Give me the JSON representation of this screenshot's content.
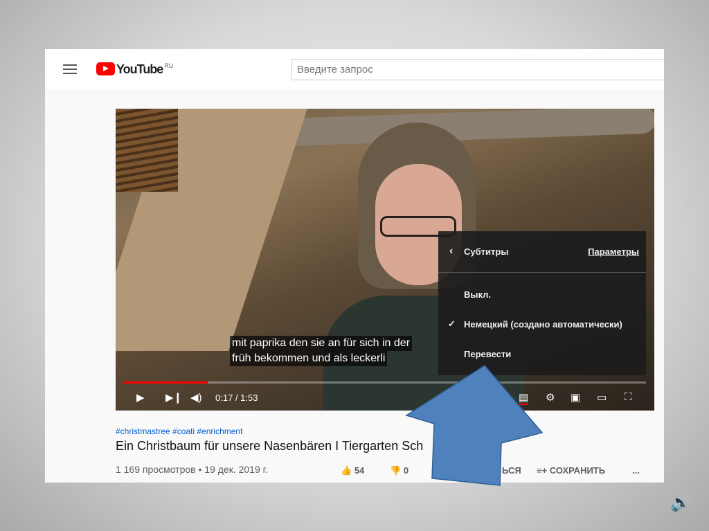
{
  "header": {
    "logo_text": "YouTube",
    "logo_region": "RU",
    "search_placeholder": "Введите запрос"
  },
  "video": {
    "subtitles": [
      "mit paprika den sie an für sich in der",
      "früh bekommen und als leckerli"
    ],
    "time": "0:17 / 1:53",
    "progress": 0.16
  },
  "subtitle_menu": {
    "title": "Субтитры",
    "options_link": "Параметры",
    "items": [
      {
        "label": "Выкл.",
        "checked": false
      },
      {
        "label": "Немецкий (создано автоматически)",
        "checked": true
      },
      {
        "label": "Перевести",
        "checked": false
      }
    ]
  },
  "info": {
    "tags": "#christmastree #coati #enrichment",
    "title": "Ein Christbaum für unsere Nasenbären I Tiergarten Sch",
    "meta": "1 169 просмотров • 19 дек. 2019 г.",
    "likes": "54",
    "dislikes": "0",
    "share_partial": "ЬСЯ",
    "save": "СОХРАНИТЬ",
    "more": "..."
  },
  "colors": {
    "arrow": "#4f81bd",
    "accent": "#ff0000"
  }
}
